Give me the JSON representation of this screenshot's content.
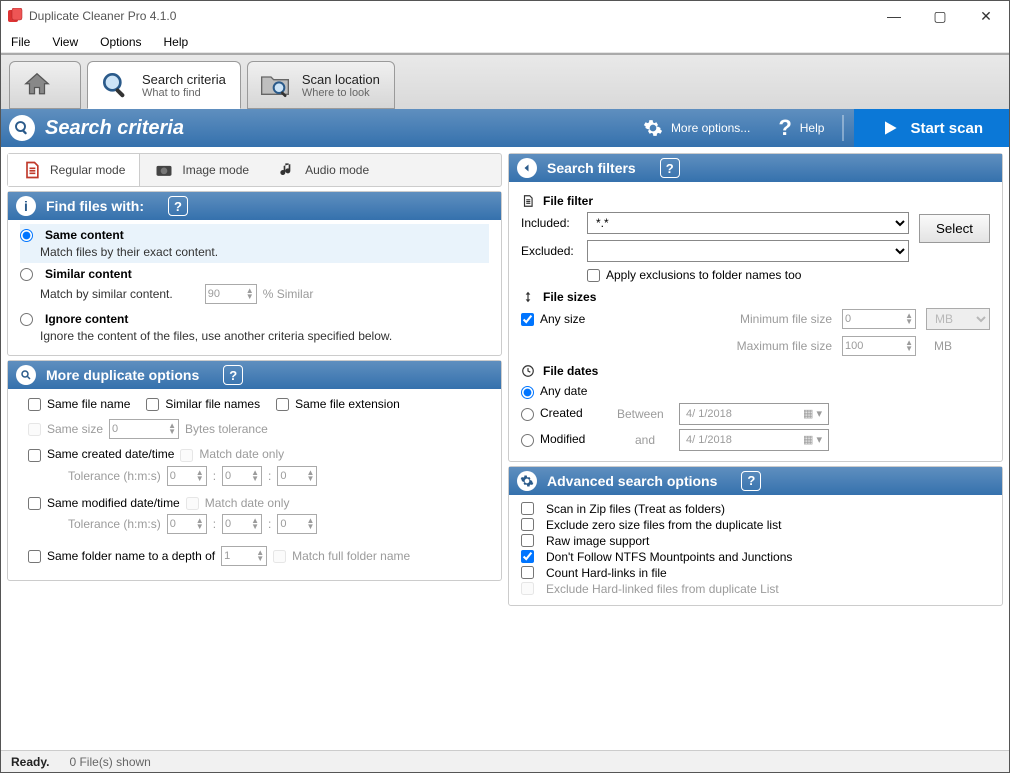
{
  "window": {
    "title": "Duplicate Cleaner Pro 4.1.0"
  },
  "menu": {
    "file": "File",
    "view": "View",
    "options": "Options",
    "help": "Help"
  },
  "tabs": {
    "home": {
      "title": "",
      "sub": ""
    },
    "search_criteria": {
      "title": "Search criteria",
      "sub": "What to find"
    },
    "scan_location": {
      "title": "Scan location",
      "sub": "Where to look"
    }
  },
  "toolbar": {
    "title": "Search criteria",
    "more_options": "More options...",
    "help": "Help",
    "start_scan": "Start scan"
  },
  "modes": {
    "regular": "Regular mode",
    "image": "Image mode",
    "audio": "Audio mode"
  },
  "find_files": {
    "title": "Find files with:",
    "same_content": {
      "label": "Same content",
      "sub": "Match files by their exact content."
    },
    "similar_content": {
      "label": "Similar content",
      "sub": "Match by similar content.",
      "pct_value": "90",
      "pct_suffix": "% Similar"
    },
    "ignore_content": {
      "label": "Ignore content",
      "sub": "Ignore the content of the files, use another criteria specified below."
    }
  },
  "more_dup": {
    "title": "More duplicate options",
    "same_file_name": "Same file name",
    "similar_file_names": "Similar file names",
    "same_ext": "Same file extension",
    "same_size": "Same size",
    "bytes_tolerance": "Bytes tolerance",
    "same_created": "Same created date/time",
    "same_modified": "Same modified date/time",
    "match_date_only": "Match date only",
    "tolerance_label": "Tolerance (h:m:s)",
    "tol_h": "0",
    "tol_m": "0",
    "tol_s": "0",
    "same_folder_depth": "Same folder name to a depth of",
    "depth_value": "1",
    "match_full_folder": "Match full folder name",
    "size_tol_value": "0"
  },
  "search_filters": {
    "title": "Search filters",
    "file_filter": {
      "title": "File filter",
      "included_label": "Included:",
      "included_value": "*.*",
      "excluded_label": "Excluded:",
      "excluded_value": "",
      "select_btn": "Select",
      "apply_exclusions": "Apply exclusions to folder names too"
    },
    "file_sizes": {
      "title": "File sizes",
      "any_size": "Any size",
      "min_label": "Minimum file size",
      "min_value": "0",
      "max_label": "Maximum file size",
      "max_value": "100",
      "unit": "MB"
    },
    "file_dates": {
      "title": "File dates",
      "any_date": "Any date",
      "created": "Created",
      "modified": "Modified",
      "between": "Between",
      "and": "and",
      "date1": "4/  1/2018",
      "date2": "4/  1/2018"
    }
  },
  "advanced": {
    "title": "Advanced search options",
    "scan_zip": "Scan in Zip files (Treat as folders)",
    "exclude_zero": "Exclude zero size files from the duplicate list",
    "raw_image": "Raw image support",
    "no_ntfs": "Don't Follow NTFS Mountpoints and Junctions",
    "count_hardlinks": "Count Hard-links in file",
    "exclude_hardlinked": "Exclude Hard-linked files from duplicate List"
  },
  "status": {
    "ready": "Ready.",
    "files": "0 File(s) shown"
  }
}
